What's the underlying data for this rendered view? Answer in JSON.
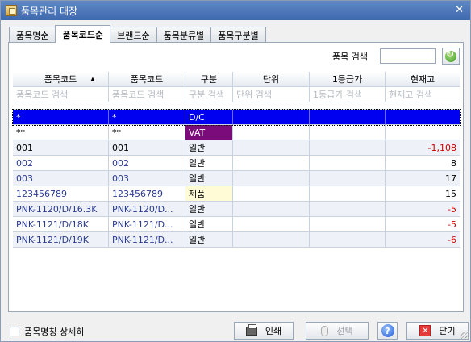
{
  "window": {
    "title": "품목관리 대장"
  },
  "tabs": [
    "품목명순",
    "품목코드순",
    "브랜드순",
    "품목분류별",
    "품목구분별"
  ],
  "active_tab": 1,
  "search": {
    "label": "품목 검색",
    "value": ""
  },
  "grid": {
    "headers": [
      "품목코드",
      "품목코드",
      "구분",
      "단위",
      "1등급가",
      "현재고"
    ],
    "sort_icon": "▲",
    "filters": [
      "품목코드 검색",
      "품목코드 검색",
      "구분 검색",
      "단위 검색",
      "1등급가 검색",
      "현재고 검색"
    ],
    "rows": [
      {
        "c0": "*",
        "c1": "*",
        "c2": "D/C",
        "c3": "",
        "c4": "",
        "c5": ""
      },
      {
        "c0": "**",
        "c1": "**",
        "c2": "VAT",
        "c3": "",
        "c4": "",
        "c5": ""
      },
      {
        "c0": "001",
        "c1": "001",
        "c2": "일반",
        "c3": "",
        "c4": "",
        "c5": "-1,108"
      },
      {
        "c0": "002",
        "c1": "002",
        "c2": "일반",
        "c3": "",
        "c4": "",
        "c5": "8"
      },
      {
        "c0": "003",
        "c1": "003",
        "c2": "일반",
        "c3": "",
        "c4": "",
        "c5": "17"
      },
      {
        "c0": "123456789",
        "c1": "123456789",
        "c2": "제품",
        "c3": "",
        "c4": "",
        "c5": "15"
      },
      {
        "c0": "PNK-1120/D/16.3K",
        "c1": "PNK-1120/D...",
        "c2": "일반",
        "c3": "",
        "c4": "",
        "c5": "-5"
      },
      {
        "c0": "PNK-1121/D/18K",
        "c1": "PNK-1121/D...",
        "c2": "일반",
        "c3": "",
        "c4": "",
        "c5": "-5"
      },
      {
        "c0": "PNK-1121/D/19K",
        "c1": "PNK-1121/D...",
        "c2": "일반",
        "c3": "",
        "c4": "",
        "c5": "-6"
      }
    ]
  },
  "footer": {
    "checkbox_label": "품목명칭 상세히",
    "print_label": "인쇄",
    "select_label": "선택",
    "help_label": "?",
    "close_label": "닫기"
  },
  "icons": [
    "app-icon",
    "close-x-icon",
    "refresh-icon",
    "printer-icon",
    "mouse-icon",
    "help-icon",
    "close-icon"
  ]
}
